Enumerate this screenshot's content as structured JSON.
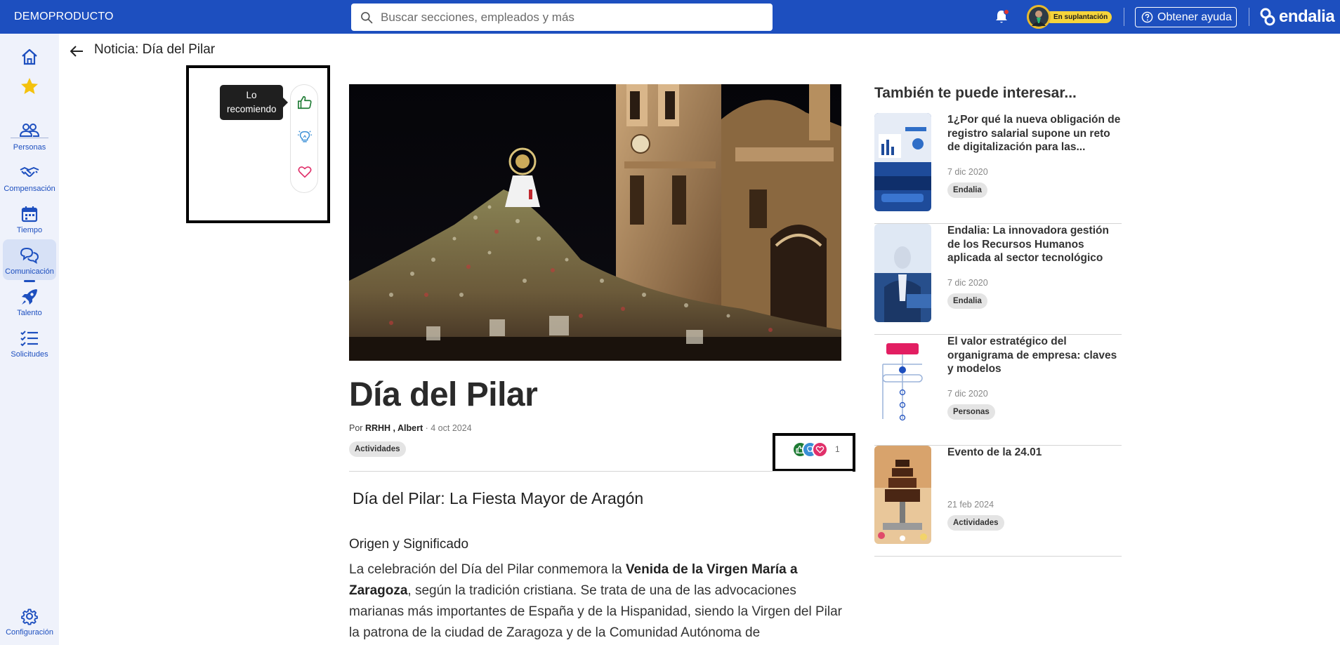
{
  "topbar": {
    "brand": "DEMOPRODUCTO",
    "search_placeholder": "Buscar secciones, empleados y más",
    "impersonation_badge": "En suplantación",
    "help_label": "Obtener ayuda",
    "logo_text": "endalia",
    "colors": {
      "bar": "#1d4fbf",
      "badge": "#f5d43b"
    }
  },
  "sidebar": {
    "items": [
      {
        "label": "",
        "icon": "home-icon"
      },
      {
        "label": "",
        "icon": "star-icon"
      },
      {
        "label": "Personas",
        "icon": "people-icon"
      },
      {
        "label": "Compensación",
        "icon": "handshake-icon"
      },
      {
        "label": "Tiempo",
        "icon": "calendar-icon"
      },
      {
        "label": "Comunicación",
        "icon": "chat-icon",
        "active": true
      },
      {
        "label": "Talento",
        "icon": "rocket-icon"
      },
      {
        "label": "Solicitudes",
        "icon": "checklist-icon"
      }
    ],
    "footer": {
      "label": "Configuración",
      "icon": "gear-icon"
    }
  },
  "page": {
    "title": "Noticia: Día del Pilar"
  },
  "reactions": {
    "tooltip": "Lo recomiendo",
    "options": [
      {
        "name": "recommend",
        "icon": "thumbs-up-icon",
        "color": "#1e7b34"
      },
      {
        "name": "inspiring",
        "icon": "lightbulb-icon",
        "color": "#3a8fd6"
      },
      {
        "name": "love",
        "icon": "heart-icon",
        "color": "#e0306a"
      }
    ],
    "count": "1"
  },
  "article": {
    "title": "Día del Pilar",
    "byline_prefix": "Por",
    "author": "RRHH , Albert",
    "date": "· 4 oct 2024",
    "tag": "Actividades",
    "heading": "Día del Pilar: La Fiesta Mayor de Aragón",
    "subheading": "Origen y Significado",
    "paragraph": {
      "p1": "La celebración del Día del Pilar conmemora la ",
      "bold": "Venida de la Virgen María a Zaragoza",
      "p2": ", según la tradición cristiana. Se trata de una de las advocaciones marianas más importantes de España y de la Hispanidad, siendo la Virgen del Pilar la patrona de la ciudad de Zaragoza y de la Comunidad Autónoma de"
    }
  },
  "related": {
    "title": "También te puede interesar...",
    "items": [
      {
        "title": "1¿Por qué la nueva obligación de registro salarial supone un reto de digitalización para las...",
        "date": "7 dic 2020",
        "tag": "Endalia"
      },
      {
        "title": "Endalia: La innovadora gestión de los Recursos Humanos aplicada al sector tecnológico",
        "date": "7 dic 2020",
        "tag": "Endalia"
      },
      {
        "title": "El valor estratégico del organigrama de empresa: claves y modelos",
        "date": "7 dic 2020",
        "tag": "Personas"
      },
      {
        "title": "Evento de la 24.01",
        "date": "21 feb 2024",
        "tag": "Actividades"
      }
    ]
  }
}
